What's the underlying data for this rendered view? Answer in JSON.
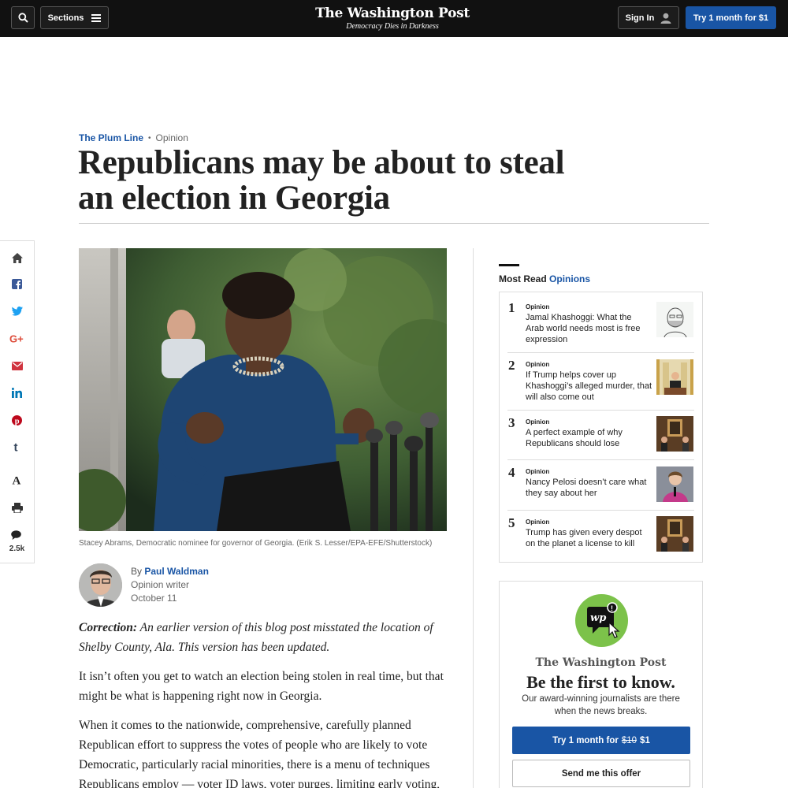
{
  "header": {
    "sections_label": "Sections",
    "logo_name": "The Washington Post",
    "logo_tagline": "Democracy Dies in Darkness",
    "signin_label": "Sign In",
    "trial_label": "Try 1 month for $1"
  },
  "article": {
    "kicker_section": "The Plum Line",
    "kicker_dot": "•",
    "kicker_type": "Opinion",
    "headline": "Republicans may be about to steal an election in Georgia",
    "caption": "Stacey Abrams, Democratic nominee for governor of Georgia. (Erik S. Lesser/EPA-EFE/Shutterstock)",
    "by_prefix": "By",
    "author": "Paul Waldman",
    "author_role": "Opinion writer",
    "date": "October 11",
    "correction_label": "Correction:",
    "correction_text": " An earlier version of this blog post misstated the location of Shelby County, Ala. This version has been updated.",
    "paragraph_2": "It isn’t often you get to watch an election being stolen in real time, but that might be what is happening right now in Georgia.",
    "paragraph_3": "When it comes to the nationwide, comprehensive, carefully planned Republican effort to suppress the votes of people who are likely to vote Democratic, particularly racial minorities, there is a menu of techniques Republicans employ — voter ID laws, voter purges, limiting early voting, closing polling places in"
  },
  "share": {
    "comment_count": "2.5k",
    "icons": [
      "home-icon",
      "facebook-icon",
      "twitter-icon",
      "google-plus-icon",
      "email-icon",
      "linkedin-icon",
      "pinterest-icon",
      "tumblr-icon",
      "text-size-icon",
      "print-icon",
      "comments-icon"
    ]
  },
  "most_read": {
    "title_main": "Most Read",
    "title_accent": "Opinions",
    "items": [
      {
        "num": "1",
        "label": "Opinion",
        "headline": "Jamal Khashoggi: What the Arab world needs most is free expression"
      },
      {
        "num": "2",
        "label": "Opinion",
        "headline": "If Trump helps cover up Khashoggi’s alleged murder, that will also come out"
      },
      {
        "num": "3",
        "label": "Opinion",
        "headline": "A perfect example of why Republicans should lose"
      },
      {
        "num": "4",
        "label": "Opinion",
        "headline": "Nancy Pelosi doesn’t care what they say about her"
      },
      {
        "num": "5",
        "label": "Opinion",
        "headline": "Trump has given every despot on the planet a license to kill"
      }
    ]
  },
  "promo": {
    "logo": "The Washington Post",
    "headline": "Be the first to know.",
    "subtext": "Our award-winning journalists are there when the news breaks.",
    "btn_prefix": "Try 1 month for",
    "btn_old_price": "$10",
    "btn_new_price": "$1",
    "offer_label": "Send me this offer"
  },
  "colors": {
    "brand_blue": "#1955a5",
    "topbar": "#111111",
    "promo_green": "#7cc24a"
  }
}
